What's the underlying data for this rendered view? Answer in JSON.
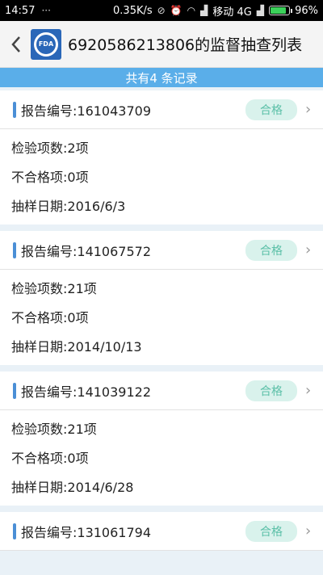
{
  "status_bar": {
    "time": "14:57",
    "net_speed": "0.35K/s",
    "carrier": "移动 4G",
    "battery": "96%",
    "battery_level": 0.96
  },
  "header": {
    "title": "6920586213806的监督抽查列表",
    "logo_text": "FDA"
  },
  "summary": "共有4 条记录",
  "records": [
    {
      "report_no": "报告编号:161043709",
      "status": "合格",
      "items": "检验项数:2项",
      "fail": "不合格项:0项",
      "date": "抽样日期:2016/6/3"
    },
    {
      "report_no": "报告编号:141067572",
      "status": "合格",
      "items": "检验项数:21项",
      "fail": "不合格项:0项",
      "date": "抽样日期:2014/10/13"
    },
    {
      "report_no": "报告编号:141039122",
      "status": "合格",
      "items": "检验项数:21项",
      "fail": "不合格项:0项",
      "date": "抽样日期:2014/6/28"
    },
    {
      "report_no": "报告编号:131061794",
      "status": "合格"
    }
  ]
}
